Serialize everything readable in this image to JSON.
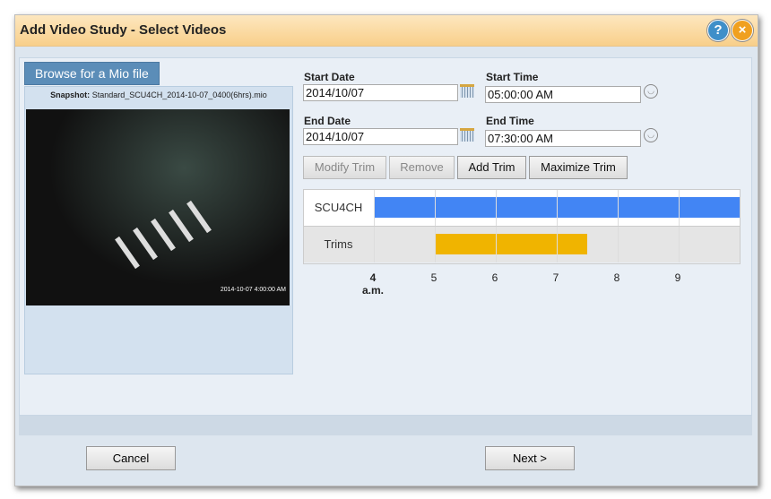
{
  "title": "Add Video Study - Select Videos",
  "browse_label": "Browse for a Mio file",
  "snapshot": {
    "label": "Snapshot:",
    "file": "Standard_SCU4CH_2014-10-07_0400(6hrs).mio",
    "timestamp": "2014-10-07 4:00:00 AM"
  },
  "start_date": {
    "label": "Start Date",
    "value": "2014/10/07"
  },
  "start_time": {
    "label": "Start Time",
    "value": "05:00:00 AM"
  },
  "end_date": {
    "label": "End Date",
    "value": "2014/10/07"
  },
  "end_time": {
    "label": "End Time",
    "value": "07:30:00 AM"
  },
  "buttons": {
    "modify": "Modify Trim",
    "remove": "Remove",
    "add": "Add Trim",
    "maximize": "Maximize Trim",
    "cancel": "Cancel",
    "next": "Next >"
  },
  "timeline": {
    "rows": [
      {
        "label": "SCU4CH",
        "start": 4,
        "end": 10,
        "color": "#4285f4"
      },
      {
        "label": "Trims",
        "start": 5,
        "end": 7.5,
        "color": "#f0b400"
      }
    ],
    "range": [
      4,
      10
    ],
    "ticks": [
      "4",
      "5",
      "6",
      "7",
      "8",
      "9"
    ],
    "first_tick_sub": "a.m."
  }
}
